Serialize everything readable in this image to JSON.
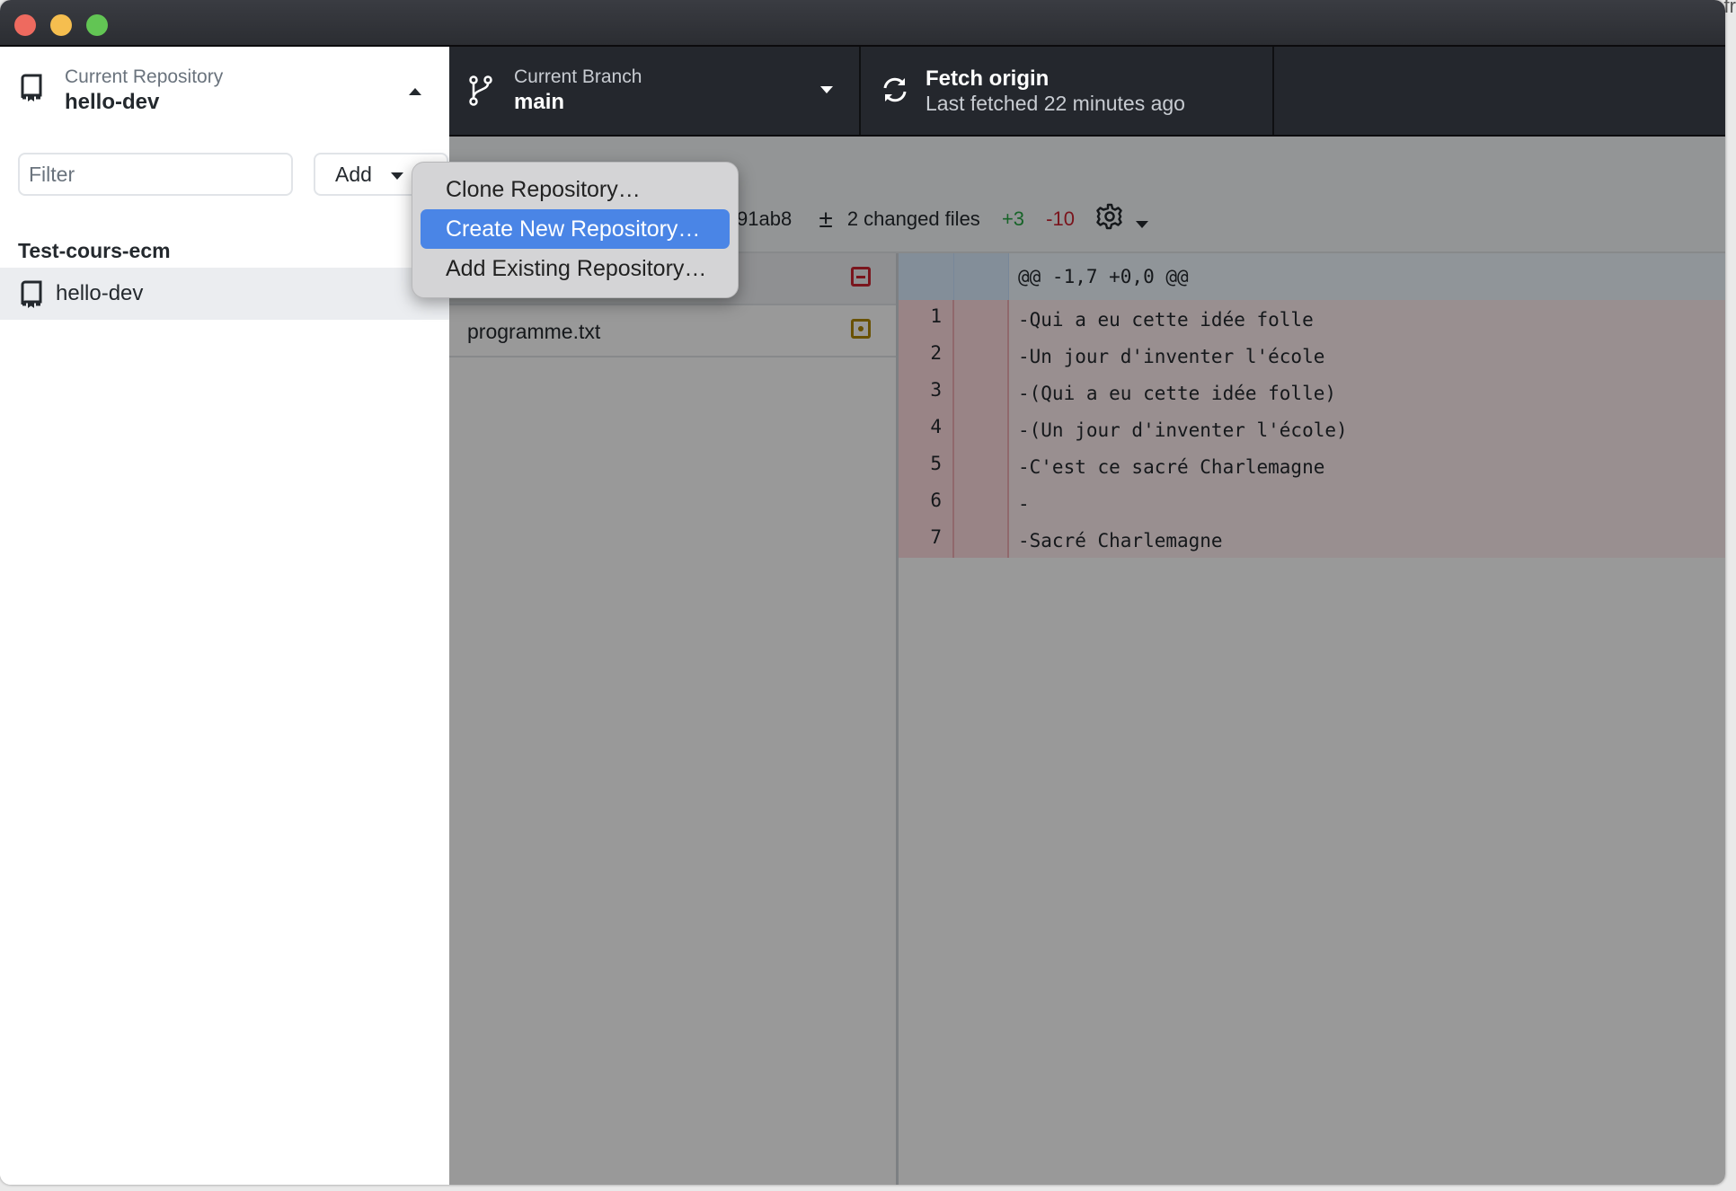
{
  "window": {
    "traffic_lights": [
      "close",
      "minimize",
      "zoom"
    ]
  },
  "background_text": "fr",
  "sidebar": {
    "repo_label": "Current Repository",
    "repo_name": "hello-dev",
    "filter_placeholder": "Filter",
    "filter_value": "",
    "add_label": "Add",
    "group_heading": "Test-cours-ecm",
    "repos": [
      {
        "name": "hello-dev",
        "selected": true
      }
    ]
  },
  "toolbar": {
    "branch_label": "Current Branch",
    "branch_name": "main",
    "fetch_title": "Fetch origin",
    "fetch_subtitle": "Last fetched 22 minutes ago"
  },
  "commit": {
    "sha_partial": "91ab8",
    "changed_files": "2 changed files",
    "additions": "+3",
    "deletions": "-10"
  },
  "files": [
    {
      "name": "",
      "status": "deleted",
      "selected": true
    },
    {
      "name": "programme.txt",
      "status": "modified",
      "selected": false
    }
  ],
  "diff": {
    "hunk": "@@ -1,7 +0,0 @@",
    "lines": [
      {
        "old": "1",
        "new": "",
        "text": "-Qui a eu cette idée folle"
      },
      {
        "old": "2",
        "new": "",
        "text": "-Un jour d'inventer l'école"
      },
      {
        "old": "3",
        "new": "",
        "text": "-(Qui a eu cette idée folle)"
      },
      {
        "old": "4",
        "new": "",
        "text": "-(Un jour d'inventer l'école)"
      },
      {
        "old": "5",
        "new": "",
        "text": "-C'est ce sacré Charlemagne"
      },
      {
        "old": "6",
        "new": "",
        "text": "-"
      },
      {
        "old": "7",
        "new": "",
        "text": "-Sacré Charlemagne"
      }
    ]
  },
  "add_menu": {
    "items": [
      {
        "label": "Clone Repository…",
        "active": false
      },
      {
        "label": "Create New Repository…",
        "active": true
      },
      {
        "label": "Add Existing Repository…",
        "active": false
      }
    ]
  },
  "colors": {
    "accent": "#4a85e6",
    "addition": "#28a745",
    "deletion": "#cb2431",
    "modified": "#b08800",
    "toolbar_bg": "#24272d"
  }
}
